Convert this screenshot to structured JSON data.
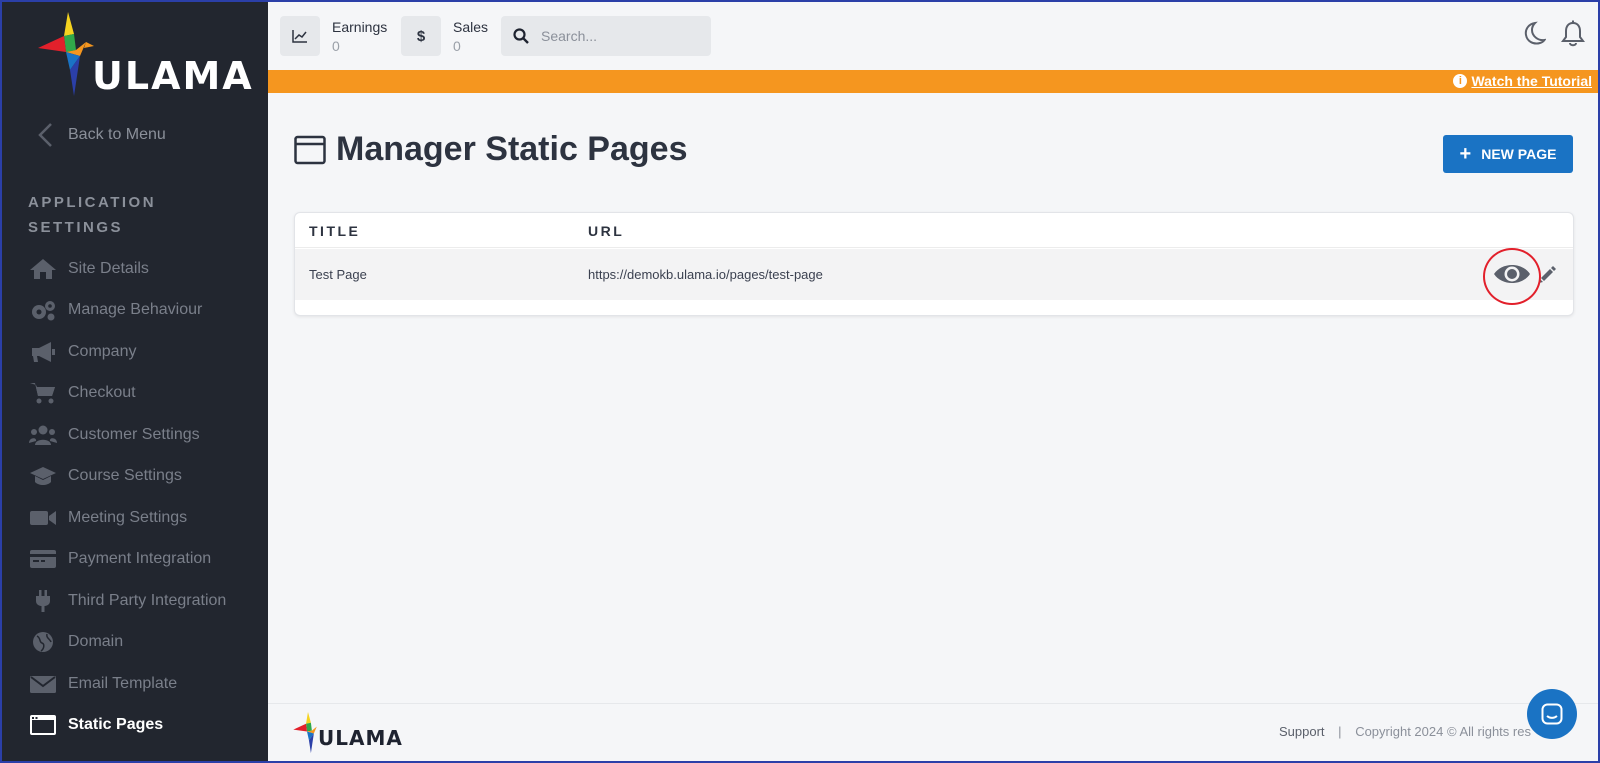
{
  "sidebar": {
    "logo_text": "ULAMA",
    "back_label": "Back to Menu",
    "section_title": "APPLICATION SETTINGS",
    "items": [
      {
        "label": "Site Details",
        "icon": "home-icon"
      },
      {
        "label": "Manage Behaviour",
        "icon": "gears-icon"
      },
      {
        "label": "Company",
        "icon": "megaphone-icon"
      },
      {
        "label": "Checkout",
        "icon": "cart-icon"
      },
      {
        "label": "Customer Settings",
        "icon": "users-icon"
      },
      {
        "label": "Course Settings",
        "icon": "graduation-cap-icon"
      },
      {
        "label": "Meeting Settings",
        "icon": "video-camera-icon"
      },
      {
        "label": "Payment Integration",
        "icon": "payment-card-icon"
      },
      {
        "label": "Third Party Integration",
        "icon": "plug-icon"
      },
      {
        "label": "Domain",
        "icon": "globe-icon"
      },
      {
        "label": "Email Template",
        "icon": "envelope-icon"
      },
      {
        "label": "Static Pages",
        "icon": "window-icon",
        "active": true
      }
    ]
  },
  "topbar": {
    "earnings_label": "Earnings",
    "earnings_value": "0",
    "sales_label": "Sales",
    "sales_value": "0",
    "sales_icon_glyph": "$",
    "search_placeholder": "Search..."
  },
  "banner": {
    "link_text": "Watch the Tutorial",
    "info_glyph": "i",
    "color": "#f5961f"
  },
  "main": {
    "title": "Manager Static Pages",
    "new_button_label": "NEW PAGE",
    "new_button_glyph": "+",
    "table": {
      "headers": [
        "TITLE",
        "URL"
      ],
      "rows": [
        {
          "title": "Test Page",
          "url": "https://demokb.ulama.io/pages/test-page"
        }
      ]
    }
  },
  "footer": {
    "logo_text": "ULAMA",
    "support_label": "Support",
    "separator": "|",
    "copyright": "Copyright 2024 © All rights res"
  },
  "colors": {
    "sidebar_bg": "#22262f",
    "accent_blue": "#1a73c4",
    "banner_orange": "#f5961f",
    "highlight_red": "#e2202b"
  }
}
